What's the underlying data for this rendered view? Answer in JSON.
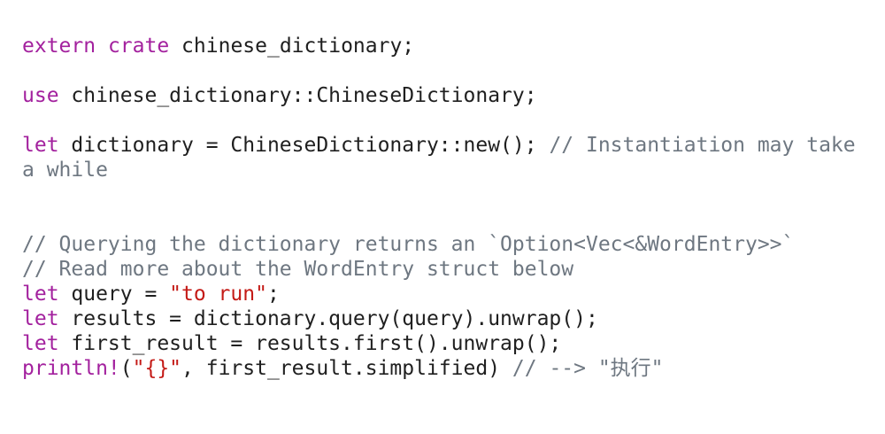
{
  "code": {
    "line1": {
      "kw1": "extern",
      "sp": " ",
      "kw2": "crate",
      "rest": " chinese_dictionary;"
    },
    "line2": {
      "kw": "use",
      "rest": " chinese_dictionary::ChineseDictionary;"
    },
    "line3": {
      "kw": "let",
      "rest": " dictionary = ChineseDictionary::new(); ",
      "comment": "// Instantiation may take a while"
    },
    "line4": {
      "comment": "// Querying the dictionary returns an `Option<Vec<&WordEntry>>`"
    },
    "line5": {
      "comment": "// Read more about the WordEntry struct below"
    },
    "line6": {
      "kw": "let",
      "rest": " query = ",
      "str": "\"to run\"",
      "end": ";"
    },
    "line7": {
      "kw": "let",
      "rest": " results = dictionary.query(query).unwrap();"
    },
    "line8": {
      "kw": "let",
      "rest": " first_result = results.first().unwrap();"
    },
    "line9": {
      "kw": "println!",
      "open": "(",
      "str": "\"{}\"",
      "rest": ", first_result.simplified) ",
      "comment": "// --> \"执行\""
    }
  },
  "colors": {
    "keyword": "#a3219e",
    "string": "#c41a16",
    "comment": "#6e7781",
    "text": "#1f1f1f",
    "background": "#ffffff"
  }
}
